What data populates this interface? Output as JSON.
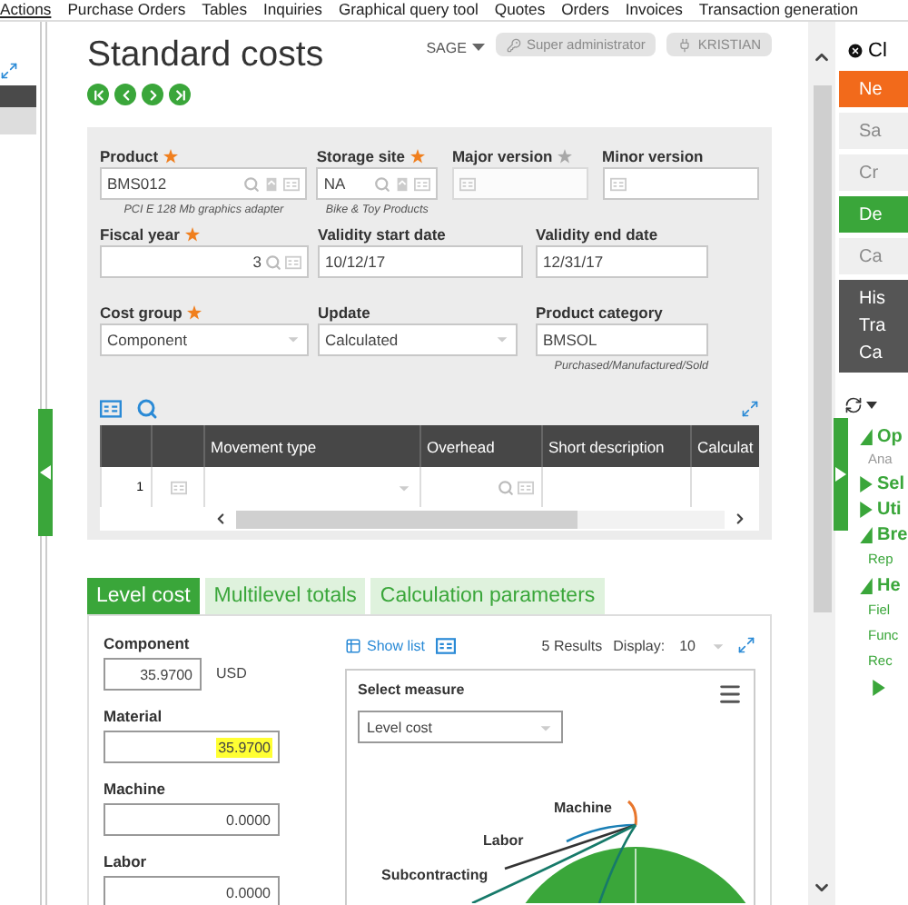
{
  "menu": [
    {
      "label": "Actions",
      "selected": true
    },
    {
      "label": "Purchase Orders",
      "selected": false
    },
    {
      "label": "Tables",
      "selected": false
    },
    {
      "label": "Inquiries",
      "selected": false
    },
    {
      "label": "Graphical query tool",
      "selected": false
    },
    {
      "label": "Quotes",
      "selected": false
    },
    {
      "label": "Orders",
      "selected": false
    },
    {
      "label": "Invoices",
      "selected": false
    },
    {
      "label": "Transaction generation",
      "selected": false
    }
  ],
  "page": {
    "title": "Standard costs",
    "folder": "SAGE",
    "role": "Super administrator",
    "user": "KRISTIAN"
  },
  "form": {
    "rows": [
      [
        {
          "label": "Product",
          "mandatory": true,
          "disabled": false,
          "kind": "input",
          "value": "BMS012",
          "subtitle": "PCI E 128 Mb graphics adapter",
          "icons": [
            {
              "kind": "search"
            },
            {
              "kind": "select"
            },
            {
              "kind": "detail"
            }
          ]
        },
        {
          "label": "Storage site",
          "mandatory": true,
          "disabled": false,
          "kind": "input",
          "value": "NA",
          "subtitle": "Bike & Toy Products",
          "icons": [
            {
              "kind": "search"
            },
            {
              "kind": "select"
            },
            {
              "kind": "detail"
            }
          ]
        },
        {
          "label": "Major version",
          "mandatory": true,
          "disabled": true,
          "kind": "input",
          "icons": [
            {
              "kind": "detail"
            }
          ]
        },
        {
          "label": "Minor version",
          "mandatory": false,
          "disabled": false,
          "kind": "input",
          "icons": [
            {
              "kind": "detail"
            }
          ]
        }
      ],
      [
        {
          "label": "Fiscal year",
          "mandatory": true,
          "disabled": false,
          "kind": "input",
          "value": "3",
          "numeric": true,
          "icons": [
            {
              "kind": "search"
            },
            {
              "kind": "detail"
            }
          ]
        },
        {
          "label": "Validity start date",
          "mandatory": false,
          "disabled": false,
          "kind": "input",
          "value": "10/12/17"
        },
        {
          "label": "Validity end date",
          "mandatory": false,
          "disabled": false,
          "kind": "input",
          "value": "12/31/17"
        }
      ],
      [
        {
          "label": "Cost group",
          "mandatory": true,
          "disabled": false,
          "kind": "select",
          "value": "Component"
        },
        {
          "label": "Update",
          "mandatory": false,
          "disabled": false,
          "kind": "select",
          "value": "Calculated"
        },
        {
          "label": "Product category",
          "mandatory": false,
          "disabled": false,
          "kind": "input",
          "value": "BMSOL",
          "subtitle": "Purchased/Manufactured/Sold"
        }
      ]
    ]
  },
  "table": {
    "columns": [
      "Movement type",
      "Overhead",
      "Short description",
      "Calculat"
    ],
    "rows": [
      {
        "number": "1"
      }
    ]
  },
  "tabs": [
    {
      "label": "Level cost",
      "selected": true
    },
    {
      "label": "Multilevel totals",
      "selected": false
    },
    {
      "label": "Calculation parameters",
      "selected": false
    }
  ],
  "costs": [
    {
      "label": "Component",
      "value": "35.9700",
      "unit": "USD",
      "highlighted": false
    },
    {
      "label": "Material",
      "value": "35.9700",
      "highlighted": true
    },
    {
      "label": "Machine",
      "value": "0.0000",
      "highlighted": false
    },
    {
      "label": "Labor",
      "value": "0.0000",
      "highlighted": false
    }
  ],
  "results": {
    "show_list": "Show list",
    "count": "5 Results",
    "display_label": "Display:",
    "display_value": "10"
  },
  "chart": {
    "measure_label": "Select measure",
    "measure": "Level cost",
    "labels": [
      "Machine",
      "Labor",
      "Subcontracting"
    ]
  },
  "right_panel": {
    "close": "Cl",
    "actions": [
      {
        "label": "Ne",
        "kind": "primary"
      },
      {
        "label": "Sa",
        "kind": "disabled"
      },
      {
        "label": "Cr",
        "kind": "disabled"
      },
      {
        "label": "De",
        "kind": "success"
      },
      {
        "label": "Ca",
        "kind": "disabled"
      }
    ],
    "links": [
      "His",
      "Tra",
      "Ca"
    ],
    "tree": [
      {
        "label": "Op",
        "expanded": true,
        "children": [
          {
            "label": "Ana"
          }
        ]
      },
      {
        "label": "Sel",
        "expanded": false
      },
      {
        "label": "Uti",
        "expanded": false
      },
      {
        "label": "Bre",
        "expanded": true,
        "children": [
          {
            "label": "Rep"
          }
        ]
      },
      {
        "label": "He",
        "expanded": true,
        "children": [
          {
            "label": "Fiel"
          },
          {
            "label": "Func"
          },
          {
            "label": "Rec"
          },
          {
            "expanded": false
          }
        ]
      }
    ]
  }
}
